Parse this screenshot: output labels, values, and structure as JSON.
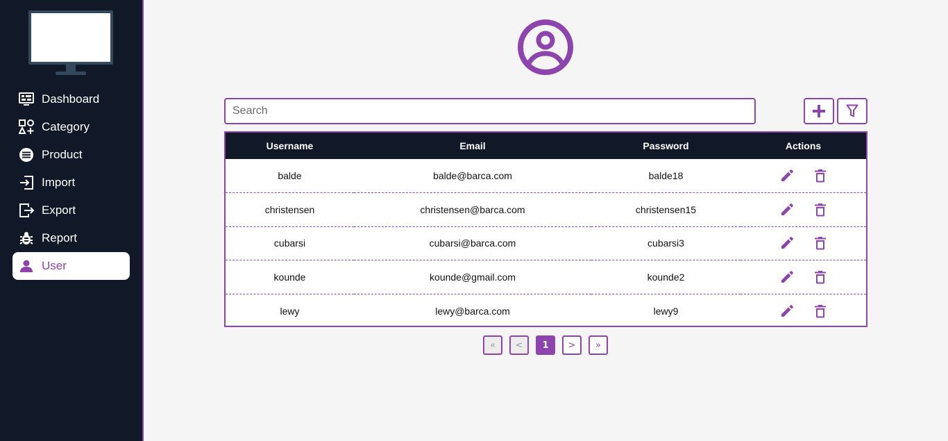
{
  "colors": {
    "accent": "#8e44ad",
    "sidebar_bg": "#111827",
    "page_bg": "#f5f5f5"
  },
  "sidebar": {
    "logo_icon": "monitor-icon",
    "items": [
      {
        "label": "Dashboard",
        "icon": "dashboard-icon",
        "active": false
      },
      {
        "label": "Category",
        "icon": "category-icon",
        "active": false
      },
      {
        "label": "Product",
        "icon": "product-icon",
        "active": false
      },
      {
        "label": "Import",
        "icon": "import-icon",
        "active": false
      },
      {
        "label": "Export",
        "icon": "export-icon",
        "active": false
      },
      {
        "label": "Report",
        "icon": "bug-icon",
        "active": false
      },
      {
        "label": "User",
        "icon": "user-icon",
        "active": true
      }
    ]
  },
  "main": {
    "header_icon": "user-circle-icon",
    "search": {
      "placeholder": "Search",
      "value": ""
    },
    "add_icon": "plus-icon",
    "filter_icon": "filter-icon",
    "table": {
      "columns": [
        "Username",
        "Email",
        "Password",
        "Actions"
      ],
      "rows": [
        {
          "username": "balde",
          "email": "balde@barca.com",
          "password": "balde18"
        },
        {
          "username": "christensen",
          "email": "christensen@barca.com",
          "password": "christensen15"
        },
        {
          "username": "cubarsi",
          "email": "cubarsi@barca.com",
          "password": "cubarsi3"
        },
        {
          "username": "kounde",
          "email": "kounde@gmail.com",
          "password": "kounde2"
        },
        {
          "username": "lewy",
          "email": "lewy@barca.com",
          "password": "lewy9"
        }
      ],
      "row_actions": [
        "edit-icon",
        "trash-icon"
      ]
    },
    "pagination": {
      "first": "«",
      "prev": "<",
      "current": "1",
      "next": ">",
      "last": "»"
    }
  }
}
